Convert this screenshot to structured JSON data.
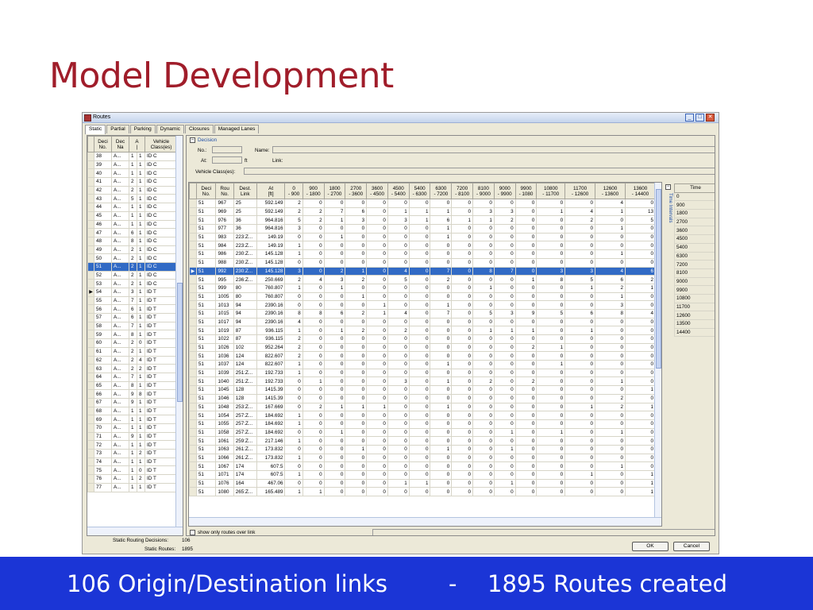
{
  "slide": {
    "title": "Model Development",
    "footer_left": "106 Origin/Destination links",
    "footer_dash": "-",
    "footer_right": "1895 Routes created"
  },
  "window": {
    "title": "Routes",
    "buttons": {
      "minimize": "_",
      "maximize": "□",
      "close": "✕"
    }
  },
  "tabs": [
    "Static",
    "Partial",
    "Parking",
    "Dynamic",
    "Closures",
    "Managed Lanes"
  ],
  "decision_list": {
    "headers": [
      [
        "Deci",
        "No."
      ],
      [
        "Dec",
        "Na"
      ],
      [
        "A",
        "|"
      ],
      [
        "Vehicle",
        "Class(es)"
      ]
    ],
    "rows": [
      [
        "38",
        "A...",
        "1",
        "1",
        "ID C"
      ],
      [
        "39",
        "A...",
        "1",
        "1",
        "ID C"
      ],
      [
        "40",
        "A...",
        "1",
        "1",
        "ID C"
      ],
      [
        "41",
        "A...",
        "2",
        "1",
        "ID C"
      ],
      [
        "42",
        "A...",
        "2",
        "1",
        "ID C"
      ],
      [
        "43",
        "A...",
        "5",
        "1",
        "ID C"
      ],
      [
        "44",
        "A...",
        "1",
        "1",
        "ID C"
      ],
      [
        "45",
        "A...",
        "1",
        "1",
        "ID C"
      ],
      [
        "46",
        "A...",
        "1",
        "1",
        "ID C"
      ],
      [
        "47",
        "A...",
        "6",
        "1",
        "ID C"
      ],
      [
        "48",
        "A...",
        "8",
        "1",
        "ID C"
      ],
      [
        "49",
        "A...",
        "2",
        "1",
        "ID C"
      ],
      [
        "50",
        "A...",
        "2",
        "1",
        "ID C"
      ],
      [
        "51",
        "A...",
        "2",
        "1",
        "ID C"
      ],
      [
        "52",
        "A...",
        "2",
        "1",
        "ID C"
      ],
      [
        "53",
        "A...",
        "2",
        "1",
        "ID C"
      ],
      [
        "54",
        "A...",
        "3",
        "1",
        "ID T"
      ],
      [
        "55",
        "A...",
        "7",
        "1",
        "ID T"
      ],
      [
        "56",
        "A...",
        "6",
        "1",
        "ID T"
      ],
      [
        "57",
        "A...",
        "6",
        "1",
        "ID T"
      ],
      [
        "58",
        "A...",
        "7",
        "1",
        "ID T"
      ],
      [
        "59",
        "A...",
        "8",
        "1",
        "ID T"
      ],
      [
        "60",
        "A...",
        "2",
        "0",
        "ID T"
      ],
      [
        "61",
        "A...",
        "2",
        "1",
        "ID T"
      ],
      [
        "62",
        "A...",
        "2",
        "4",
        "ID T"
      ],
      [
        "63",
        "A...",
        "2",
        "2",
        "ID T"
      ],
      [
        "64",
        "A...",
        "7",
        "1",
        "ID T"
      ],
      [
        "65",
        "A...",
        "8",
        "1",
        "ID T"
      ],
      [
        "66",
        "A...",
        "9",
        "8",
        "ID T"
      ],
      [
        "67",
        "A...",
        "9",
        "1",
        "ID T"
      ],
      [
        "68",
        "A...",
        "1",
        "1",
        "ID T"
      ],
      [
        "69",
        "A...",
        "1",
        "1",
        "ID T"
      ],
      [
        "70",
        "A...",
        "1",
        "1",
        "ID T"
      ],
      [
        "71",
        "A...",
        "9",
        "1",
        "ID T"
      ],
      [
        "72",
        "A...",
        "1",
        "1",
        "ID T"
      ],
      [
        "73",
        "A...",
        "1",
        "2",
        "ID T"
      ],
      [
        "74",
        "A...",
        "1",
        "1",
        "ID T"
      ],
      [
        "75",
        "A...",
        "1",
        "0",
        "ID T"
      ],
      [
        "76",
        "A...",
        "1",
        "2",
        "ID T"
      ],
      [
        "77",
        "A...",
        "1",
        "1",
        "ID T"
      ]
    ],
    "selected_index": 13,
    "current_index": 16
  },
  "decision": {
    "section_label": "Decision",
    "no_label": "No.:",
    "name_label": "Name:",
    "at_label": "At:",
    "at_unit": "ft",
    "link_label": "Link:",
    "vehicle_label": "Vehicle Class(es):"
  },
  "routes": {
    "headers": [
      [
        "Deci",
        "No."
      ],
      [
        "Rou",
        "No."
      ],
      [
        "Dest.",
        "Link"
      ],
      [
        "At",
        "[ft]"
      ],
      [
        "0",
        "- 900"
      ],
      [
        "900",
        "- 1800"
      ],
      [
        "1800",
        "- 2700"
      ],
      [
        "2700",
        "- 3600"
      ],
      [
        "3600",
        "- 4500"
      ],
      [
        "4500",
        "- 5400"
      ],
      [
        "5400",
        "- 6300"
      ],
      [
        "6300",
        "- 7200"
      ],
      [
        "7200",
        "- 8100"
      ],
      [
        "8100",
        "- 9000"
      ],
      [
        "9000",
        "- 9900"
      ],
      [
        "9900",
        "- 1080"
      ],
      [
        "10800",
        "- 11700"
      ],
      [
        "11700",
        "- 12600"
      ],
      [
        "12600",
        "- 13600"
      ],
      [
        "13600",
        "- 14400"
      ]
    ],
    "rows": [
      [
        "51",
        "967",
        "25",
        "592.149",
        "2",
        "0",
        "0",
        "0",
        "0",
        "0",
        "0",
        "0",
        "0",
        "0",
        "0",
        "0",
        "0",
        "0",
        "4",
        "0"
      ],
      [
        "51",
        "969",
        "25",
        "592.149",
        "2",
        "2",
        "7",
        "6",
        "0",
        "1",
        "1",
        "1",
        "0",
        "3",
        "3",
        "0",
        "1",
        "4",
        "1",
        "13"
      ],
      [
        "51",
        "976",
        "36",
        "964.816",
        "5",
        "2",
        "1",
        "3",
        "0",
        "3",
        "1",
        "6",
        "1",
        "1",
        "2",
        "0",
        "0",
        "2",
        "0",
        "5"
      ],
      [
        "51",
        "977",
        "36",
        "964.816",
        "3",
        "0",
        "0",
        "0",
        "0",
        "0",
        "0",
        "1",
        "0",
        "0",
        "0",
        "0",
        "0",
        "0",
        "1",
        "0"
      ],
      [
        "51",
        "983",
        "223:Z...",
        "149.19",
        "0",
        "0",
        "1",
        "0",
        "0",
        "0",
        "0",
        "1",
        "0",
        "0",
        "0",
        "0",
        "0",
        "0",
        "0",
        "0"
      ],
      [
        "51",
        "984",
        "223:Z...",
        "149.19",
        "1",
        "0",
        "0",
        "0",
        "0",
        "0",
        "0",
        "0",
        "0",
        "0",
        "0",
        "0",
        "0",
        "0",
        "0",
        "0"
      ],
      [
        "51",
        "986",
        "230:Z...",
        "145.128",
        "1",
        "0",
        "0",
        "0",
        "0",
        "0",
        "0",
        "0",
        "0",
        "0",
        "0",
        "0",
        "0",
        "0",
        "1",
        "0"
      ],
      [
        "51",
        "988",
        "230:Z...",
        "145.128",
        "0",
        "0",
        "0",
        "0",
        "0",
        "0",
        "0",
        "0",
        "0",
        "0",
        "0",
        "0",
        "0",
        "0",
        "0",
        "0"
      ],
      [
        "51",
        "992",
        "230:Z...",
        "145.128",
        "3",
        "0",
        "2",
        "1",
        "0",
        "4",
        "0",
        "7",
        "0",
        "8",
        "7",
        "0",
        "3",
        "3",
        "4",
        "6"
      ],
      [
        "51",
        "995",
        "236:Z...",
        "250.669",
        "2",
        "4",
        "3",
        "2",
        "0",
        "5",
        "0",
        "2",
        "0",
        "0",
        "0",
        "1",
        "8",
        "5",
        "6",
        "2"
      ],
      [
        "51",
        "999",
        "80",
        "760.807",
        "1",
        "0",
        "1",
        "0",
        "0",
        "0",
        "0",
        "0",
        "0",
        "1",
        "0",
        "0",
        "0",
        "1",
        "2",
        "1"
      ],
      [
        "51",
        "1005",
        "80",
        "760.807",
        "0",
        "0",
        "0",
        "1",
        "0",
        "0",
        "0",
        "0",
        "0",
        "0",
        "0",
        "0",
        "0",
        "0",
        "1",
        "0"
      ],
      [
        "51",
        "1013",
        "94",
        "2390.16",
        "0",
        "0",
        "0",
        "0",
        "1",
        "0",
        "0",
        "1",
        "0",
        "0",
        "0",
        "0",
        "0",
        "0",
        "3",
        "0"
      ],
      [
        "51",
        "1015",
        "94",
        "2390.16",
        "8",
        "8",
        "6",
        "2",
        "1",
        "4",
        "0",
        "7",
        "0",
        "5",
        "3",
        "9",
        "5",
        "6",
        "8",
        "4"
      ],
      [
        "51",
        "1017",
        "94",
        "2390.16",
        "4",
        "0",
        "0",
        "0",
        "0",
        "0",
        "0",
        "0",
        "0",
        "0",
        "0",
        "0",
        "0",
        "0",
        "0",
        "0"
      ],
      [
        "51",
        "1019",
        "87",
        "936.115",
        "1",
        "0",
        "1",
        "2",
        "0",
        "2",
        "0",
        "0",
        "0",
        "1",
        "1",
        "1",
        "0",
        "1",
        "0",
        "0"
      ],
      [
        "51",
        "1022",
        "87",
        "936.115",
        "2",
        "0",
        "0",
        "0",
        "0",
        "0",
        "0",
        "0",
        "0",
        "0",
        "0",
        "0",
        "0",
        "0",
        "0",
        "0"
      ],
      [
        "51",
        "1026",
        "102",
        "952.264",
        "2",
        "0",
        "0",
        "0",
        "0",
        "0",
        "0",
        "0",
        "0",
        "0",
        "0",
        "2",
        "1",
        "0",
        "0",
        "0"
      ],
      [
        "51",
        "1036",
        "124",
        "822.607",
        "2",
        "0",
        "0",
        "0",
        "0",
        "0",
        "0",
        "0",
        "0",
        "0",
        "0",
        "0",
        "0",
        "0",
        "0",
        "0"
      ],
      [
        "51",
        "1037",
        "124",
        "822.607",
        "1",
        "0",
        "0",
        "0",
        "0",
        "0",
        "0",
        "1",
        "0",
        "0",
        "0",
        "0",
        "1",
        "0",
        "0",
        "0"
      ],
      [
        "51",
        "1039",
        "251:Z...",
        "192.733",
        "1",
        "0",
        "0",
        "0",
        "0",
        "0",
        "0",
        "0",
        "0",
        "0",
        "0",
        "0",
        "0",
        "0",
        "0",
        "0"
      ],
      [
        "51",
        "1040",
        "251:Z...",
        "192.733",
        "0",
        "1",
        "0",
        "0",
        "0",
        "3",
        "0",
        "1",
        "0",
        "2",
        "0",
        "2",
        "0",
        "0",
        "1",
        "0"
      ],
      [
        "51",
        "1045",
        "128",
        "1415.39",
        "0",
        "0",
        "0",
        "0",
        "0",
        "0",
        "0",
        "0",
        "0",
        "0",
        "0",
        "0",
        "0",
        "0",
        "0",
        "1"
      ],
      [
        "51",
        "1046",
        "128",
        "1415.39",
        "0",
        "0",
        "0",
        "0",
        "0",
        "0",
        "0",
        "0",
        "0",
        "0",
        "0",
        "0",
        "0",
        "0",
        "2",
        "0"
      ],
      [
        "51",
        "1048",
        "253:Z...",
        "167.669",
        "0",
        "2",
        "1",
        "1",
        "1",
        "0",
        "0",
        "1",
        "0",
        "0",
        "0",
        "0",
        "0",
        "1",
        "2",
        "1"
      ],
      [
        "51",
        "1054",
        "257:Z...",
        "184.692",
        "1",
        "0",
        "0",
        "0",
        "0",
        "0",
        "0",
        "0",
        "0",
        "0",
        "0",
        "0",
        "0",
        "0",
        "0",
        "0"
      ],
      [
        "51",
        "1055",
        "257:Z...",
        "184.692",
        "1",
        "0",
        "0",
        "0",
        "0",
        "0",
        "0",
        "0",
        "0",
        "0",
        "0",
        "0",
        "0",
        "0",
        "0",
        "0"
      ],
      [
        "51",
        "1058",
        "257:Z...",
        "184.692",
        "0",
        "0",
        "1",
        "0",
        "0",
        "0",
        "0",
        "0",
        "0",
        "0",
        "1",
        "0",
        "1",
        "0",
        "1",
        "0"
      ],
      [
        "51",
        "1061",
        "259:Z...",
        "217.146",
        "1",
        "0",
        "0",
        "0",
        "0",
        "0",
        "0",
        "0",
        "0",
        "0",
        "0",
        "0",
        "0",
        "0",
        "0",
        "0"
      ],
      [
        "51",
        "1063",
        "261:Z...",
        "173.832",
        "0",
        "0",
        "0",
        "1",
        "0",
        "0",
        "0",
        "1",
        "0",
        "0",
        "1",
        "0",
        "0",
        "0",
        "0",
        "0"
      ],
      [
        "51",
        "1066",
        "261:Z...",
        "173.832",
        "1",
        "0",
        "0",
        "0",
        "0",
        "0",
        "0",
        "0",
        "0",
        "0",
        "0",
        "0",
        "0",
        "0",
        "0",
        "0"
      ],
      [
        "51",
        "1067",
        "174",
        "607.5",
        "0",
        "0",
        "0",
        "0",
        "0",
        "0",
        "0",
        "0",
        "0",
        "0",
        "0",
        "0",
        "0",
        "0",
        "1",
        "0"
      ],
      [
        "51",
        "1071",
        "174",
        "607.5",
        "1",
        "0",
        "0",
        "0",
        "0",
        "0",
        "0",
        "0",
        "0",
        "0",
        "0",
        "0",
        "0",
        "1",
        "0",
        "1"
      ],
      [
        "51",
        "1076",
        "164",
        "467.06",
        "0",
        "0",
        "0",
        "0",
        "0",
        "1",
        "1",
        "0",
        "0",
        "0",
        "1",
        "0",
        "0",
        "0",
        "0",
        "1"
      ],
      [
        "51",
        "1080",
        "265:Z...",
        "165.489",
        "1",
        "1",
        "0",
        "0",
        "0",
        "0",
        "0",
        "0",
        "0",
        "0",
        "0",
        "0",
        "0",
        "0",
        "0",
        "1"
      ]
    ],
    "selected_index": 8
  },
  "time_intervals": {
    "side_label": "Time Intervals",
    "header": "Time",
    "values": [
      "0",
      "900",
      "1800",
      "2700",
      "3600",
      "4500",
      "5400",
      "6300",
      "7200",
      "8100",
      "9000",
      "9900",
      "10800",
      "11700",
      "12600",
      "13500",
      "14400"
    ]
  },
  "show_only_label": "show only routes over link",
  "stats": {
    "decisions_label": "Static Routing Decisions:",
    "decisions_value": "106",
    "routes_label": "Static Routes:",
    "routes_value": "1895"
  },
  "buttons": {
    "ok": "OK",
    "cancel": "Cancel"
  },
  "colors": {
    "title": "#a01d2a",
    "footer_bg": "#1b35d6",
    "selection": "#316ac5"
  }
}
